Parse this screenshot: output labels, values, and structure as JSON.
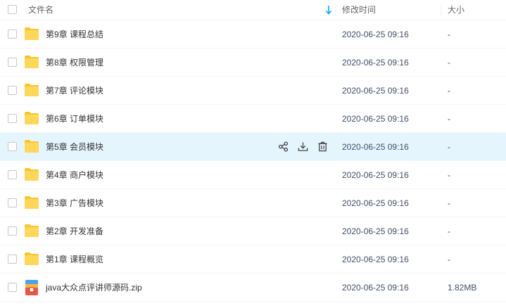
{
  "header": {
    "name_label": "文件名",
    "modified_label": "修改时间",
    "size_label": "大小"
  },
  "colors": {
    "folder": "#f9c52b",
    "accent": "#06a7ff",
    "hover_row": "#e5f5fe"
  },
  "files": [
    {
      "name": "第9章 课程总结",
      "modified": "2020-06-25 09:16",
      "size": "-",
      "type": "folder"
    },
    {
      "name": "第8章 权限管理",
      "modified": "2020-06-25 09:16",
      "size": "-",
      "type": "folder"
    },
    {
      "name": "第7章 评论模块",
      "modified": "2020-06-25 09:16",
      "size": "-",
      "type": "folder"
    },
    {
      "name": "第6章 订单模块",
      "modified": "2020-06-25 09:16",
      "size": "-",
      "type": "folder"
    },
    {
      "name": "第5章 会员模块",
      "modified": "2020-06-25 09:16",
      "size": "-",
      "type": "folder",
      "hovered": true
    },
    {
      "name": "第4章 商户模块",
      "modified": "2020-06-25 09:16",
      "size": "-",
      "type": "folder"
    },
    {
      "name": "第3章 广告模块",
      "modified": "2020-06-25 09:16",
      "size": "-",
      "type": "folder"
    },
    {
      "name": "第2章 开发准备",
      "modified": "2020-06-25 09:16",
      "size": "-",
      "type": "folder"
    },
    {
      "name": "第1章 课程概览",
      "modified": "2020-06-25 09:16",
      "size": "-",
      "type": "folder"
    },
    {
      "name": "java大众点评讲师源码.zip",
      "modified": "2020-06-25 09:16",
      "size": "1.82MB",
      "type": "zip"
    }
  ]
}
